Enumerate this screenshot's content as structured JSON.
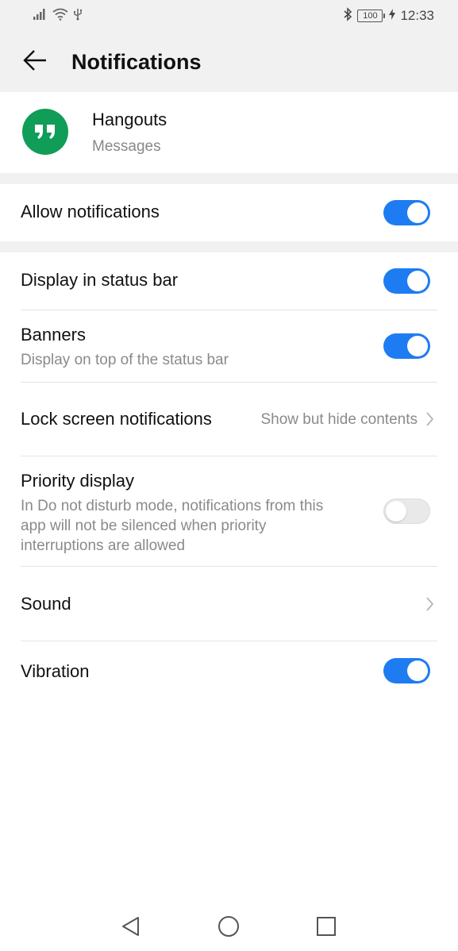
{
  "status_bar": {
    "icons_left": [
      "signal-icon",
      "wifi-icon",
      "usb-icon"
    ],
    "icons_right": [
      "bluetooth-icon",
      "battery-icon",
      "charging-icon"
    ],
    "battery": "100",
    "time": "12:33"
  },
  "app_bar": {
    "title": "Notifications",
    "back_icon": "arrow-left-icon"
  },
  "app_header": {
    "name": "Hangouts",
    "category": "Messages",
    "icon": "hangouts-icon",
    "icon_color": "#0f9d58"
  },
  "settings": {
    "allow_notifications": {
      "label": "Allow notifications",
      "enabled": true
    },
    "display_in_status_bar": {
      "label": "Display in status bar",
      "enabled": true
    },
    "banners": {
      "label": "Banners",
      "subtitle": "Display on top of the status bar",
      "enabled": true
    },
    "lock_screen": {
      "label": "Lock screen notifications",
      "value": "Show but hide contents"
    },
    "priority_display": {
      "label": "Priority display",
      "subtitle": "In Do not disturb mode, notifications from this app will not be silenced when priority interruptions are allowed",
      "enabled": false
    },
    "sound": {
      "label": "Sound"
    },
    "vibration": {
      "label": "Vibration",
      "enabled": true
    }
  },
  "colors": {
    "accent": "#1e7cf2",
    "background_gray": "#f1f1f1",
    "secondary_text": "#8a8a8a"
  },
  "nav_bar": {
    "icons": [
      "back-triangle-icon",
      "home-circle-icon",
      "recents-square-icon"
    ]
  }
}
